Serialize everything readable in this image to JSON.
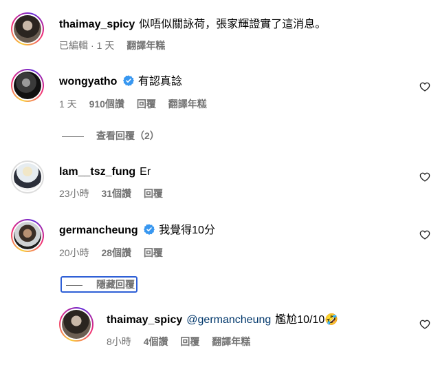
{
  "comments": [
    {
      "username": "thaimay_spicy",
      "verified": false,
      "text": "似唔似關詠荷，張家輝證實了這消息。",
      "meta": {
        "edited": "已編輯",
        "sep": "·",
        "time": "1 天",
        "translate": "翻譯年糕"
      }
    },
    {
      "username": "wongyatho",
      "verified": true,
      "text": "有認真諗",
      "meta": {
        "time": "1 天",
        "likes": "910個讚",
        "reply": "回覆",
        "translate": "翻譯年糕"
      },
      "replies_toggle": "查看回覆（2）"
    },
    {
      "username": "lam__tsz_fung",
      "verified": false,
      "text": "Er",
      "meta": {
        "time": "23小時",
        "likes": "31個讚",
        "reply": "回覆"
      }
    },
    {
      "username": "germancheung",
      "verified": true,
      "text": "我覺得10分",
      "meta": {
        "time": "20小時",
        "likes": "28個讚",
        "reply": "回覆"
      },
      "replies_toggle": "隱藏回覆"
    },
    {
      "username": "thaimay_spicy",
      "verified": false,
      "mention": "@germancheung",
      "text": "尷尬10/10🤣",
      "meta": {
        "time": "8小時",
        "likes": "4個讚",
        "reply": "回覆",
        "translate": "翻譯年糕"
      }
    }
  ],
  "colors": {
    "verified": "#3897f0",
    "meta": "#737373",
    "mention": "#00376b",
    "focus_outline": "#2e5fd6"
  },
  "icons": {
    "like": "heart-outline-icon",
    "verified": "verified-badge-icon"
  }
}
